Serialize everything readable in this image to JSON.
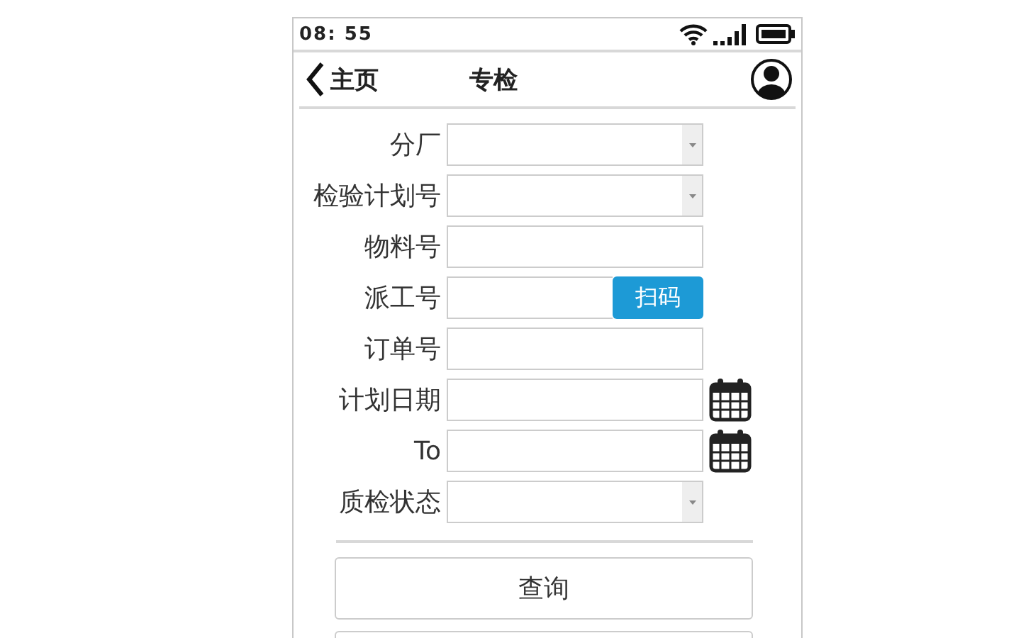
{
  "status_bar": {
    "time": "08: 55"
  },
  "nav": {
    "back_label": "主页",
    "title": "专检"
  },
  "form": {
    "fields": [
      {
        "label": "分厂",
        "kind": "select"
      },
      {
        "label": "检验计划号",
        "kind": "select"
      },
      {
        "label": "物料号",
        "kind": "text"
      },
      {
        "label": "派工号",
        "kind": "scan",
        "button": "扫码"
      },
      {
        "label": "订单号",
        "kind": "text"
      },
      {
        "label": "计划日期",
        "kind": "date"
      },
      {
        "label": "To",
        "kind": "date"
      },
      {
        "label": "质检状态",
        "kind": "select"
      }
    ]
  },
  "buttons": [
    {
      "kind": "text",
      "label": "查询"
    },
    {
      "kind": "blank"
    }
  ]
}
